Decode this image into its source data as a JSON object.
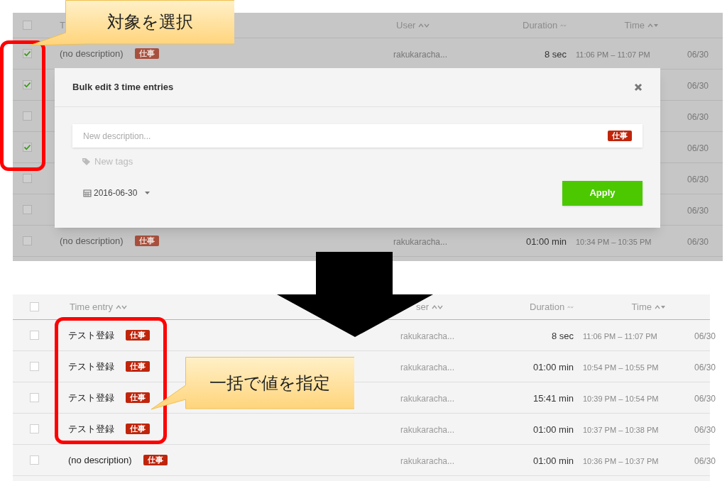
{
  "before": {
    "header": {
      "checked": false,
      "entry": "T",
      "user": "User",
      "duration": "Duration",
      "time": "Time"
    },
    "rows": [
      {
        "checked": true,
        "description": "(no description)",
        "tag": "仕事",
        "user": "rakukaracha...",
        "duration": "8 sec",
        "time": "11:06 PM – 11:07 PM",
        "date": "06/30"
      },
      {
        "checked": true,
        "date": "06/30"
      },
      {
        "checked": false,
        "date": "06/30"
      },
      {
        "checked": true,
        "date": "06/30"
      },
      {
        "checked": false,
        "date": "06/30"
      },
      {
        "checked": false,
        "date": "06/30"
      },
      {
        "checked": false,
        "description": "(no description)",
        "tag": "仕事",
        "user": "rakukaracha...",
        "duration": "01:00 min",
        "time": "10:34 PM – 10:35 PM",
        "date": "06/30"
      }
    ],
    "dialog": {
      "title": "Bulk edit 3 time entries",
      "description_placeholder": "New description...",
      "tag": "仕事",
      "tags_placeholder": "New tags",
      "date": "2016-06-30",
      "apply": "Apply"
    }
  },
  "after": {
    "header": {
      "checked": false,
      "entry": "Time entry",
      "user": "ser",
      "duration": "Duration",
      "time": "Time"
    },
    "rows": [
      {
        "checked": false,
        "description": "テスト登録",
        "tag": "仕事",
        "user": "rakukaracha...",
        "duration": "8 sec",
        "time": "11:06 PM – 11:07 PM",
        "date": "06/30"
      },
      {
        "checked": false,
        "description": "テスト登録",
        "tag": "仕事",
        "user": "rakukaracha...",
        "duration": "01:00 min",
        "time": "10:54 PM – 10:55 PM",
        "date": "06/30"
      },
      {
        "checked": false,
        "description": "テスト登録",
        "tag": "仕事",
        "user": "rakukaracha...",
        "duration": "15:41 min",
        "time": "10:39 PM – 10:54 PM",
        "date": "06/30"
      },
      {
        "checked": false,
        "description": "テスト登録",
        "tag": "仕事",
        "user": "rakukaracha...",
        "duration": "01:00 min",
        "time": "10:37 PM – 10:38 PM",
        "date": "06/30"
      },
      {
        "checked": false,
        "description": "(no description)",
        "tag": "仕事",
        "user": "rakukaracha...",
        "duration": "01:00 min",
        "time": "10:36 PM – 10:37 PM",
        "date": "06/30"
      }
    ]
  },
  "callouts": [
    "対象を選択",
    "一括で値を指定"
  ]
}
